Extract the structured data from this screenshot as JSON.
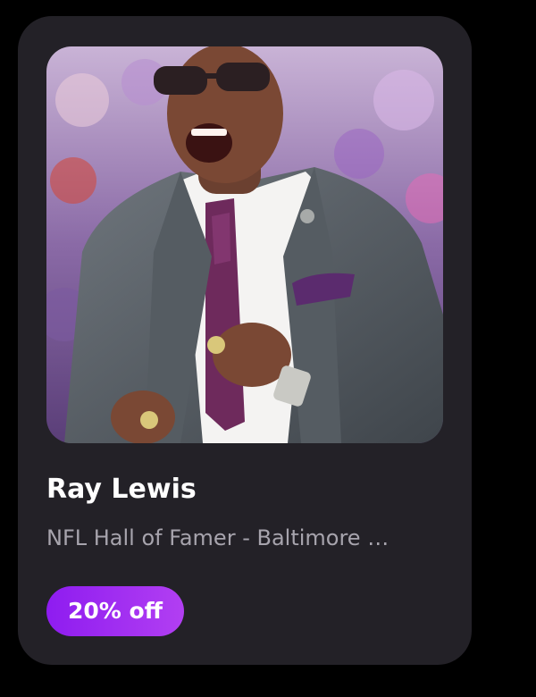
{
  "card": {
    "title": "Ray Lewis",
    "subtitle": "NFL Hall of Famer - Baltimore Ravens",
    "discount_badge": "20% off",
    "accent_color": "#9b2cf1",
    "photo": {
      "icon": "athlete-photo",
      "subject": "man in grey suit and purple tie cheering"
    }
  }
}
